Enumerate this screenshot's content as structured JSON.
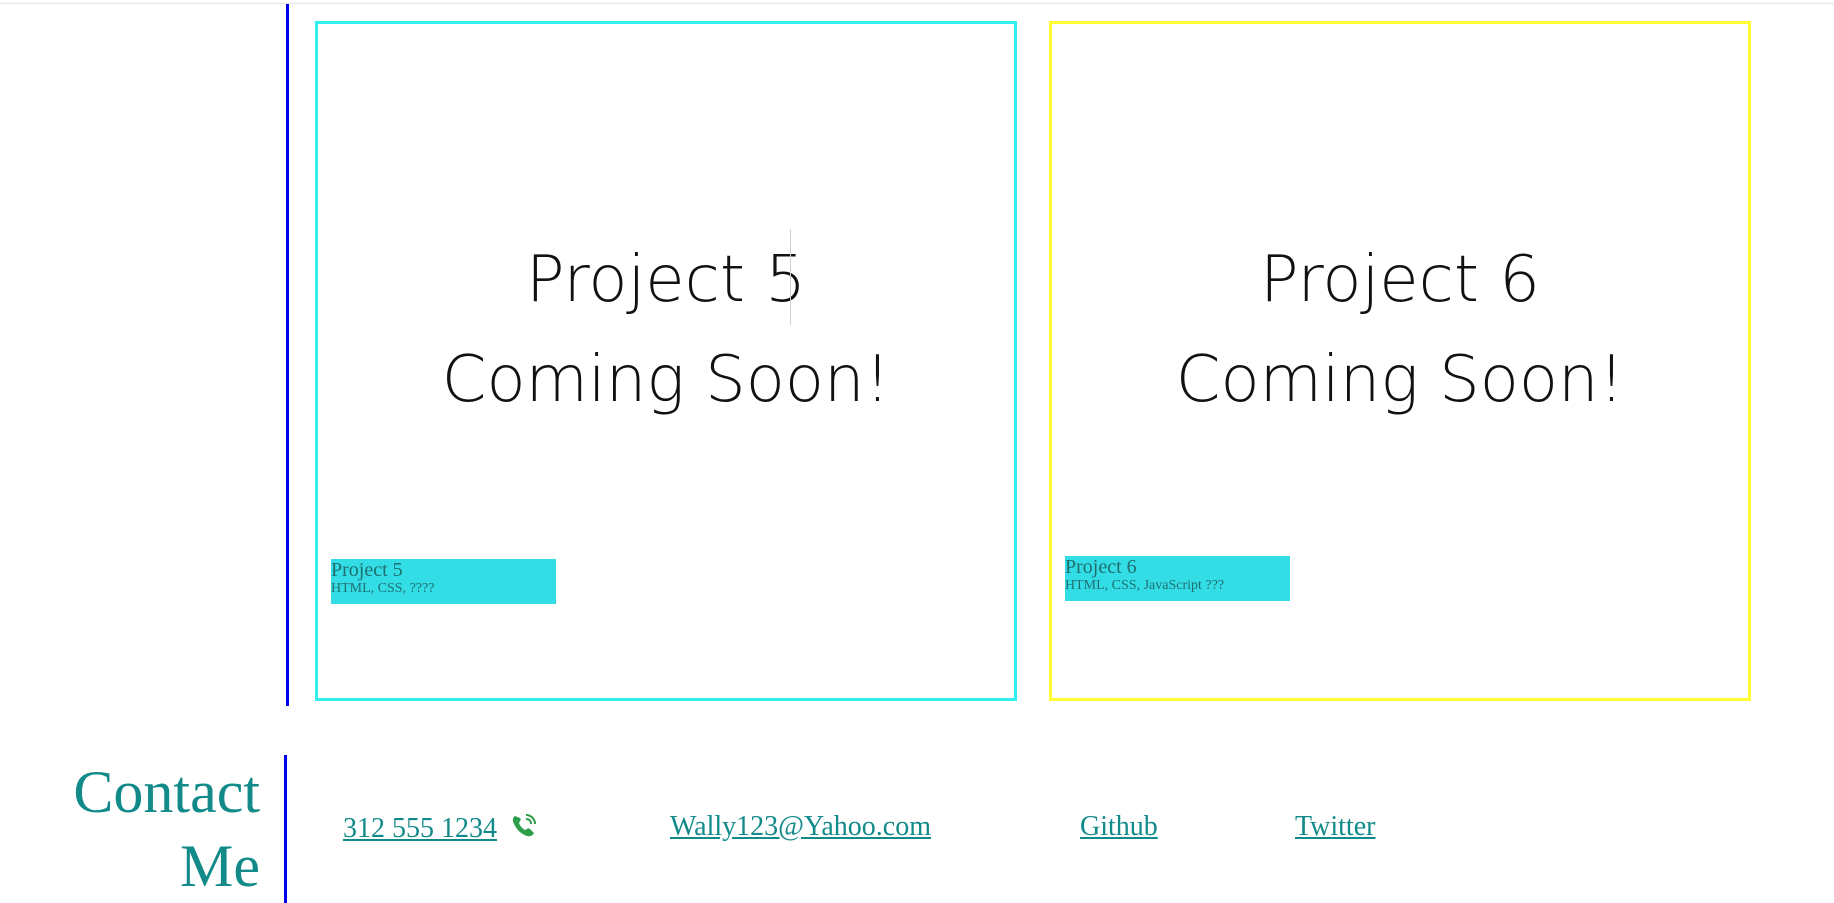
{
  "projects": [
    {
      "image_line1": "Project 5",
      "image_line2": "Coming Soon!",
      "caption_title": "Project 5",
      "caption_tech": "HTML, CSS, ????",
      "border_color": "#33eeee"
    },
    {
      "image_line1": "Project 6",
      "image_line2": "Coming Soon!",
      "caption_title": "Project 6",
      "caption_tech": "HTML, CSS, JavaScript ???",
      "border_color": "#ffff33"
    }
  ],
  "contact": {
    "heading_line1": "Contact",
    "heading_line2": "Me",
    "phone": "312 555 1234",
    "phone_icon": "phone-icon",
    "email": "Wally123@Yahoo.com",
    "github": "Github",
    "twitter": "Twitter"
  },
  "colors": {
    "teal_text": "#138a8a",
    "caption_bg": "#33dde6",
    "divider_blue": "#0000ee"
  }
}
